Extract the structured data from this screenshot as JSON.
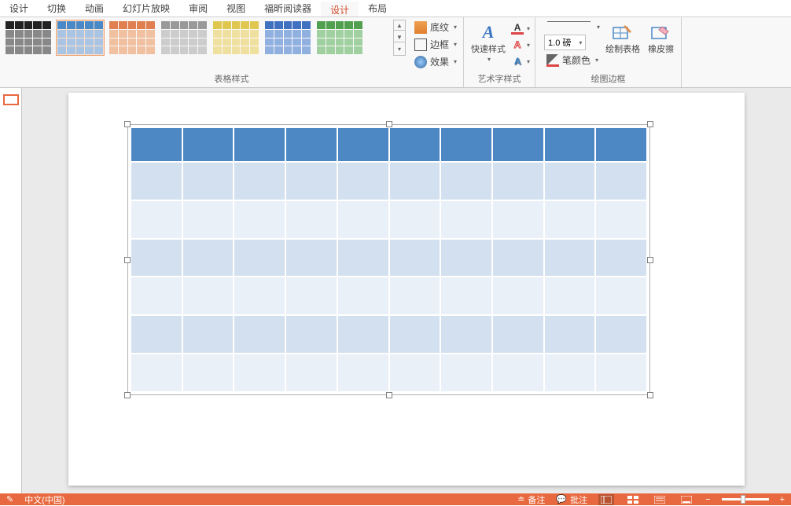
{
  "tabs": {
    "items": [
      "设计",
      "切换",
      "动画",
      "幻灯片放映",
      "审阅",
      "视图",
      "福昕阅读器",
      "设计",
      "布局"
    ],
    "active_index": 7
  },
  "ribbon": {
    "group_table_styles": "表格样式",
    "group_art_styles": "艺术字样式",
    "group_draw_borders": "绘图边框",
    "shading": "底纹",
    "borders": "边框",
    "effects": "效果",
    "quick_styles": "快速样式",
    "pen_weight_value": "1.0 磅",
    "pen_color": "笔颜色",
    "draw_table": "绘制表格",
    "eraser": "橡皮擦"
  },
  "table": {
    "rows": 7,
    "cols": 10
  },
  "statusbar": {
    "language": "中文(中国)",
    "notes": "备注",
    "comments": "批注"
  }
}
